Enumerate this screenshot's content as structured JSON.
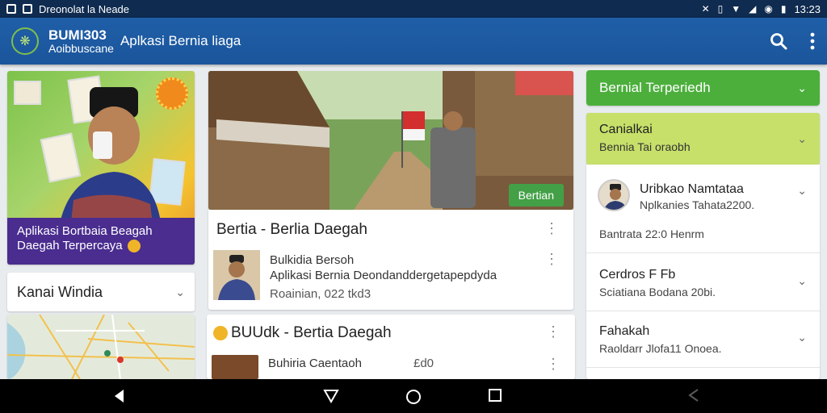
{
  "status_bar": {
    "notification_text": "Dreonolat la Neade",
    "time": "13:23"
  },
  "app_bar": {
    "brand_name": "BUMI303",
    "brand_sub": "Aoibbuscane",
    "title": "Aplkasi Bernia liaga"
  },
  "left": {
    "promo_caption": "Aplikasi Bortbaia Beagah Daegah Terpercaya",
    "channel_label": "Kanai Windia"
  },
  "middle": {
    "image_badge": "Bertian",
    "section1_title": "Bertia - Berlia Daegah",
    "item1_line1": "Bulkidia  Bersoh",
    "item1_line2": "Aplikasi Bernia Deondanddergetapepdyda",
    "item1_line3": "Roainian, 022 tkd3",
    "section2_title": "BUUdk - Bertia Daegah",
    "item2_line1": "Buhiria Caentaoh",
    "item2_line1_extra": "£d0"
  },
  "right": {
    "header": "Bernial Terperiedh",
    "selected_title": "Canialkai",
    "selected_sub": "Bennia Tai oraobh",
    "item1_title": "Uribkao Namtataa",
    "item1_sub": "Nplkanies Tahata2200.",
    "item1_meta": "Bantrata 22:0 Henrm",
    "item2_title": "Cerdros F Fb",
    "item2_sub": "Sciatiana Bodana 20bi.",
    "item3_title": "Fahakah",
    "item3_sub": "Raoldarr Jlofa11 Onoea."
  },
  "colors": {
    "app_bar": "#1f5fa8",
    "accent_green": "#4caf3c",
    "selected_green": "#c6e06a",
    "promo_purple": "#4a2d8f"
  },
  "icons": [
    "gallery-icon",
    "notification-icon",
    "search-icon",
    "more-vert-icon",
    "back-icon",
    "home-icon",
    "recents-icon",
    "chevron-down-icon",
    "kebab-icon"
  ]
}
